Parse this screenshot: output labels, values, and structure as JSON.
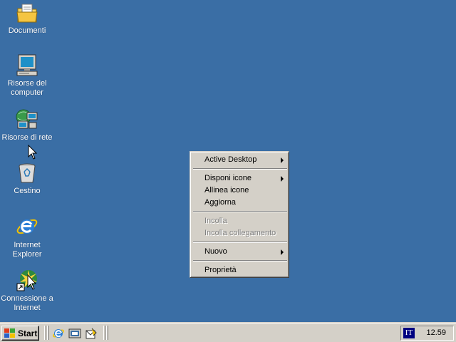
{
  "desktop": {
    "icons": [
      {
        "label": "Documenti",
        "icon": "folder-icon"
      },
      {
        "label": "Risorse del computer",
        "icon": "computer-icon"
      },
      {
        "label": "Risorse di rete",
        "icon": "network-icon"
      },
      {
        "label": "Cestino",
        "icon": "recycle-bin-icon"
      },
      {
        "label": "Internet Explorer",
        "icon": "internet-explorer-icon"
      },
      {
        "label": "Connessione a Internet",
        "icon": "internet-connection-icon"
      }
    ]
  },
  "context_menu": {
    "items": [
      {
        "label": "Active Desktop",
        "submenu": true,
        "enabled": true
      },
      {
        "label": "Disponi icone",
        "submenu": true,
        "enabled": true
      },
      {
        "label": "Allinea icone",
        "submenu": false,
        "enabled": true
      },
      {
        "label": "Aggiorna",
        "submenu": false,
        "enabled": true
      },
      {
        "label": "Incolla",
        "submenu": false,
        "enabled": false
      },
      {
        "label": "Incolla collegamento",
        "submenu": false,
        "enabled": false
      },
      {
        "label": "Nuovo",
        "submenu": true,
        "enabled": true
      },
      {
        "label": "Proprietà",
        "submenu": false,
        "enabled": true
      }
    ]
  },
  "taskbar": {
    "start_label": "Start",
    "quick_launch": [
      "internet-explorer-icon",
      "show-desktop-icon",
      "outlook-express-icon"
    ],
    "language": "IT",
    "clock": "12.59"
  },
  "colors": {
    "desktop": "#3a6ea5",
    "face": "#d4d0c8",
    "disabled_text": "#808080"
  }
}
